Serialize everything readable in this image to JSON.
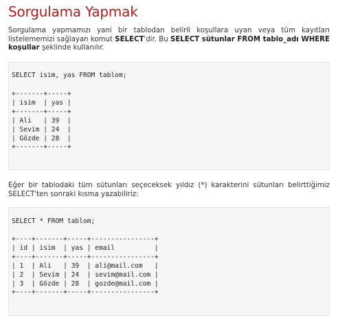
{
  "title": "Sorgulama Yapmak",
  "intro": {
    "t1": "Sorgulama yapmamızı yani bir tablodan belirli koşullara uyan veya tüm kayıtları listelememizi sağlayan komut ",
    "b1": "SELECT",
    "t2": "'dir. Bu ",
    "b2": "SELECT sütunlar FROM tablo_adı WHERE koşullar",
    "t3": " şeklinde kullanılır."
  },
  "example1": {
    "query": "SELECT isim, yas FROM tablom;",
    "table": "+-------+-----+\n| isim  | yas |\n+-------+-----+\n| Ali   | 39  |\n| Sevim | 24  |\n| Gözde | 28  |\n+-------+-----+"
  },
  "middle_text": "Eğer bir tablodaki tüm sütunları seçeceksek yıldız (*) karakterini sütunları belirttiğimiz SELECT'ten sonraki kısma yazabiliriz:",
  "example2": {
    "query": "SELECT * FROM tablom;",
    "table": "+----+-------+-----+----------------+\n| id | isim  | yas | email          |\n+----+-------+-----+----------------+\n| 1  | Ali   | 39  | ali@mail.com   |\n| 2  | Sevim | 24  | sevim@mail.com |\n| 3  | Gözde | 28  | gozde@mail.com |\n+----+-------+-----+----------------+"
  }
}
